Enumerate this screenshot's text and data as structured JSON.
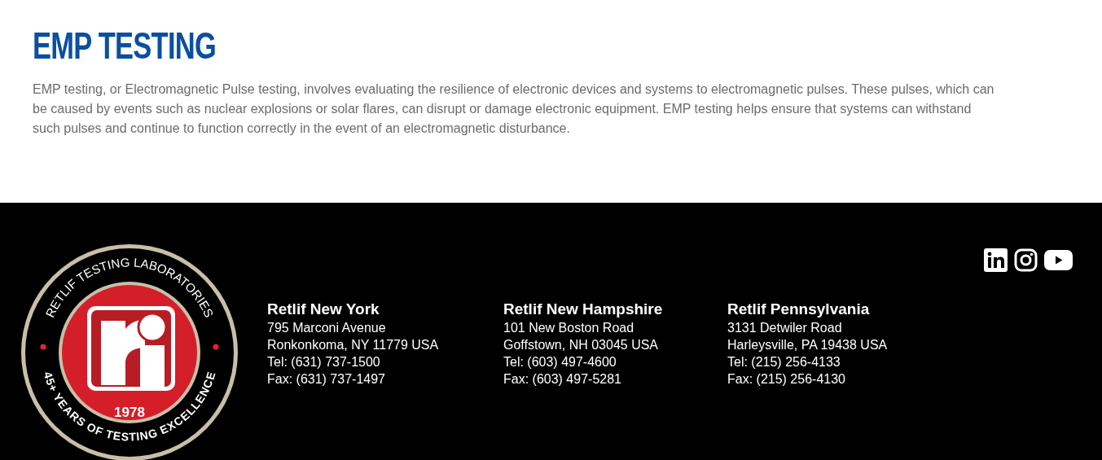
{
  "section": {
    "title": "EMP TESTING",
    "body": "EMP testing, or Electromagnetic Pulse testing, involves evaluating the resilience of electronic devices and systems to electromagnetic pulses. These pulses, which can be caused by events such as nuclear explosions or solar flares, can disrupt or damage electronic equipment. EMP testing helps ensure that systems can withstand such pulses and continue to function correctly in the event of an electromagnetic disturbance."
  },
  "footer": {
    "logo": {
      "top_text": "RETLIF TESTING LABORATORIES",
      "bottom_text": "45+ YEARS OF TESTING EXCELLENCE",
      "year": "1978"
    },
    "locations": [
      {
        "name": "Retlif New York",
        "lines": [
          "795 Marconi Avenue",
          "Ronkonkoma, NY 11779 USA",
          "Tel: (631) 737-1500",
          "Fax: (631) 737-1497"
        ]
      },
      {
        "name": "Retlif New Hampshire",
        "lines": [
          "101 New Boston Road",
          "Goffstown, NH 03045 USA",
          "Tel: (603) 497-4600",
          "Fax: (603) 497-5281"
        ]
      },
      {
        "name": "Retlif Pennsylvania",
        "lines": [
          "3131 Detwiler Road",
          "Harleysville, PA 19438 USA",
          "Tel: (215) 256-4133",
          "Fax: (215) 256-4130"
        ]
      }
    ],
    "social": [
      {
        "kind": "linkedin"
      },
      {
        "kind": "instagram"
      },
      {
        "kind": "youtube"
      }
    ]
  }
}
